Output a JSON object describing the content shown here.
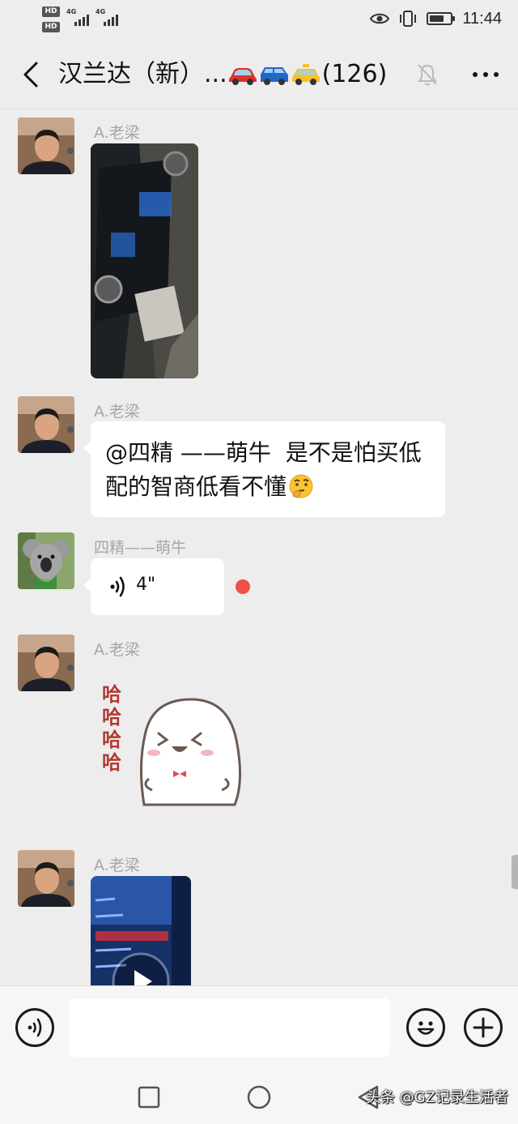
{
  "status_bar": {
    "hd_1": "HD",
    "hd_2": "HD",
    "net_1": "4G",
    "net_2": "4G",
    "time": "11:44",
    "battery_level": 0.7
  },
  "header": {
    "title": "汉兰达（新）...",
    "count": "(126)",
    "icons": [
      "back-arrow-icon",
      "red-car-emoji",
      "blue-car-emoji",
      "yellow-taxi-emoji",
      "bell-mute-icon",
      "more-dots-icon"
    ]
  },
  "messages": [
    {
      "sender": "A.老梁",
      "type": "image"
    },
    {
      "sender": "A.老梁",
      "type": "text",
      "text": "@四精 ——萌牛  是不是怕买低配的智商低看不懂"
    },
    {
      "sender": "四精——萌牛",
      "type": "voice",
      "duration": "4\"",
      "unread": true
    },
    {
      "sender": "A.老梁",
      "type": "sticker",
      "sticker_text": "哈哈哈哈"
    },
    {
      "sender": "A.老梁",
      "type": "video"
    }
  ],
  "input_bar": {
    "input_value": "",
    "icons": [
      "voice-icon",
      "emoji-icon",
      "plus-icon"
    ]
  },
  "nav_bar": {
    "icons": [
      "recent-apps-icon",
      "home-icon",
      "back-icon"
    ]
  },
  "watermark": "头条 @GZ记录生活者",
  "colors": {
    "background": "#ededed",
    "bubble": "#ffffff",
    "unread": "#f05045",
    "sender_name": "#a6a6a6"
  }
}
